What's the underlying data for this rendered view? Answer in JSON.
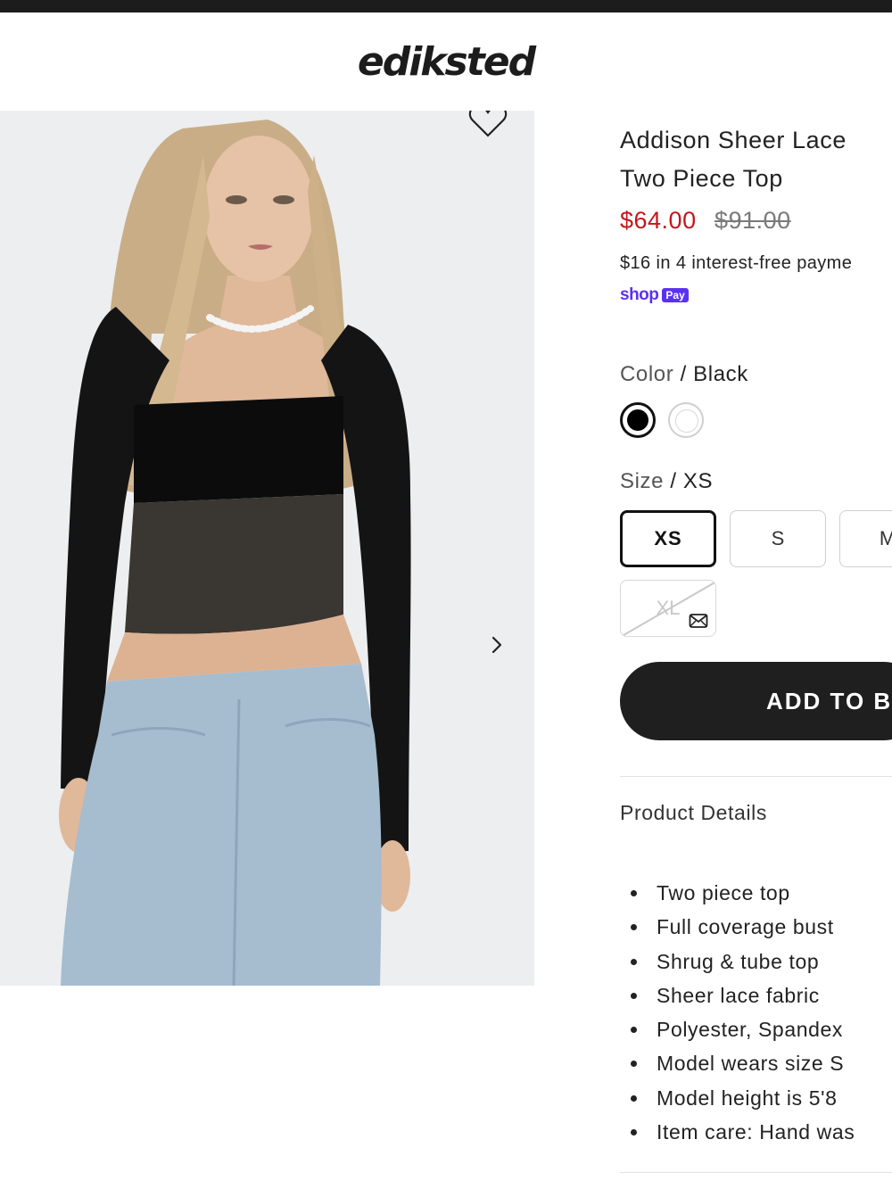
{
  "header": {
    "logo_text": "ediksted"
  },
  "gallery": {
    "image_alt": "Model wearing black sheer lace two piece top with light wash jeans"
  },
  "product": {
    "title": "Addison Sheer Lace Two Piece Top",
    "price": "$64.00",
    "compare_price": "$91.00",
    "installments": "$16 in 4 interest-free payme",
    "shop_pay": {
      "word": "shop",
      "badge": "Pay"
    }
  },
  "color": {
    "label": "Color",
    "separator": " / ",
    "selected": "Black",
    "swatches": [
      {
        "name": "Black",
        "hex": "#000000",
        "selected": true
      },
      {
        "name": "White",
        "hex": "#ffffff",
        "selected": false
      }
    ]
  },
  "size": {
    "label": "Size",
    "separator": " / ",
    "selected": "XS",
    "options": [
      "XS",
      "S",
      "M",
      "XL"
    ],
    "sold_out": [
      "XL"
    ]
  },
  "add_to_bag": "ADD TO B",
  "details": {
    "title": "Product Details",
    "items": [
      "Two piece top",
      "Full coverage bust",
      "Shrug & tube top",
      "Sheer lace fabric",
      "Polyester, Spandex",
      "Model wears size S",
      "Model height is 5'8",
      "Item care: Hand was"
    ]
  },
  "colors": {
    "sale": "#c4161c",
    "primary": "#1f1f1f",
    "shop_pay": "#5a31f4"
  },
  "icons": [
    "heart-icon",
    "chevron-right-icon",
    "mail-icon"
  ]
}
